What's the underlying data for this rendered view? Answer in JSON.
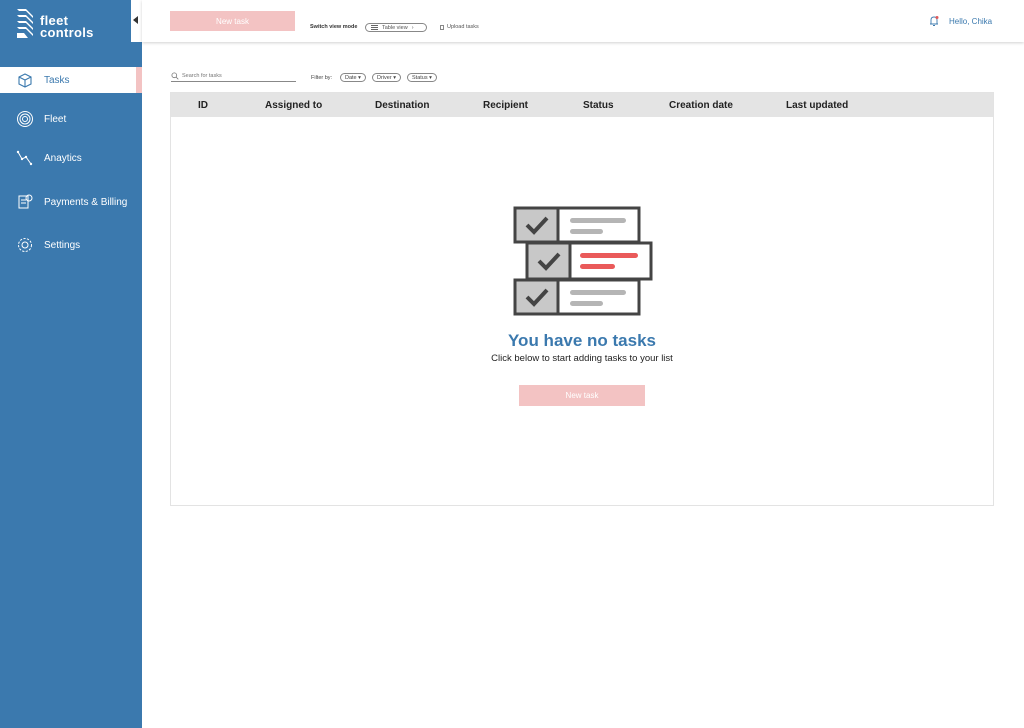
{
  "app": {
    "logo_line1": "fleet",
    "logo_line2": "controls",
    "brand_color": "#3b79ae",
    "accent_color": "#f3c3c3"
  },
  "sidebar": {
    "items": [
      {
        "label": "Tasks",
        "icon": "box-icon",
        "active": true
      },
      {
        "label": "Fleet",
        "icon": "target-icon",
        "active": false
      },
      {
        "label": "Anaytics",
        "icon": "analytics-icon",
        "active": false
      },
      {
        "label": "Payments & Billing",
        "icon": "billing-icon",
        "active": false
      },
      {
        "label": "Settings",
        "icon": "gear-icon",
        "active": false
      }
    ]
  },
  "topbar": {
    "new_task_label": "New task",
    "switch_view_label": "Switch view mode",
    "view_mode_value": "Table view",
    "upload_label": "Upload tasks",
    "greeting": "Hello, Chika"
  },
  "filters": {
    "search_placeholder": "Search for tasks",
    "filter_by_label": "Filter by:",
    "chips": [
      "Date",
      "Driver",
      "Status"
    ]
  },
  "table": {
    "columns": [
      "ID",
      "Assigned to",
      "Destination",
      "Recipient",
      "Status",
      "Creation date",
      "Last updated"
    ]
  },
  "empty_state": {
    "title": "You have no tasks",
    "subtitle": "Click below to start adding tasks to your list",
    "button_label": "New task"
  }
}
